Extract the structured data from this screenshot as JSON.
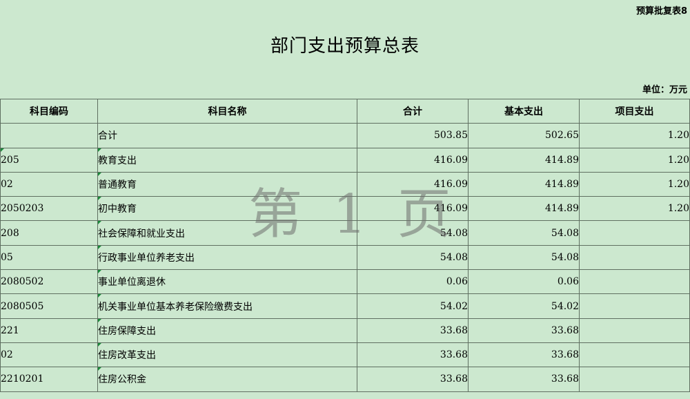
{
  "form_id": "预算批复表8",
  "title": "部门支出预算总表",
  "unit": "单位：万元",
  "headers": [
    "科目编码",
    "科目名称",
    "合计",
    "基本支出",
    "项目支出"
  ],
  "rows": [
    {
      "code": "",
      "name": "合计",
      "total": "503.85",
      "basic": "502.65",
      "project": "1.20",
      "level": 0
    },
    {
      "code": "205",
      "name": "教育支出",
      "total": "416.09",
      "basic": "414.89",
      "project": "1.20",
      "level": 0
    },
    {
      "code": "02",
      "name": "普通教育",
      "total": "416.09",
      "basic": "414.89",
      "project": "1.20",
      "level": 1
    },
    {
      "code": "2050203",
      "name": "初中教育",
      "total": "416.09",
      "basic": "414.89",
      "project": "1.20",
      "level": 2
    },
    {
      "code": "208",
      "name": "社会保障和就业支出",
      "total": "54.08",
      "basic": "54.08",
      "project": "",
      "level": 0
    },
    {
      "code": "05",
      "name": "行政事业单位养老支出",
      "total": "54.08",
      "basic": "54.08",
      "project": "",
      "level": 1
    },
    {
      "code": "2080502",
      "name": "事业单位离退休",
      "total": "0.06",
      "basic": "0.06",
      "project": "",
      "level": 2
    },
    {
      "code": "2080505",
      "name": "机关事业单位基本养老保险缴费支出",
      "total": "54.02",
      "basic": "54.02",
      "project": "",
      "level": 2
    },
    {
      "code": "221",
      "name": "住房保障支出",
      "total": "33.68",
      "basic": "33.68",
      "project": "",
      "level": 0
    },
    {
      "code": "02",
      "name": "住房改革支出",
      "total": "33.68",
      "basic": "33.68",
      "project": "",
      "level": 1
    },
    {
      "code": "2210201",
      "name": "住房公积金",
      "total": "33.68",
      "basic": "33.68",
      "project": "",
      "level": 2
    }
  ],
  "watermark": {
    "prefix": "第",
    "number": "1",
    "suffix": "页"
  }
}
